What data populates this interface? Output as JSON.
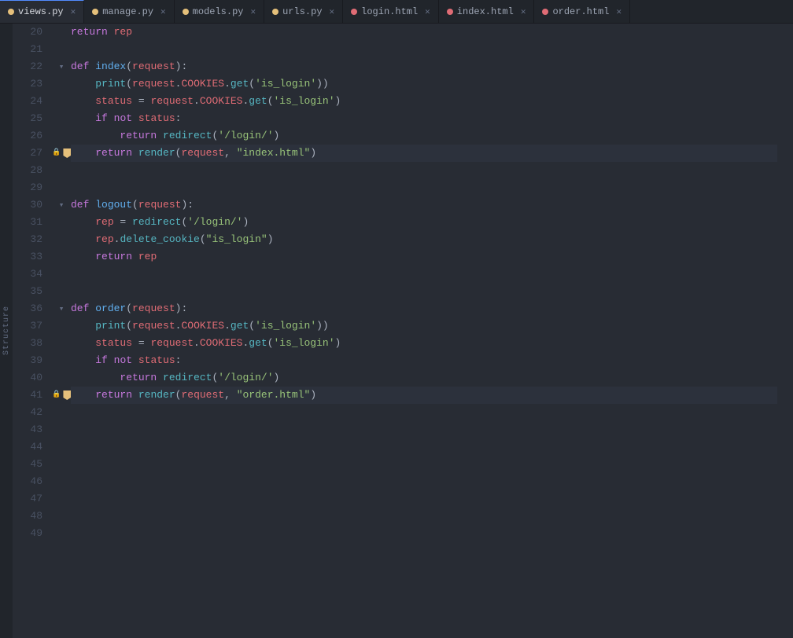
{
  "tabs": [
    {
      "id": "views-py",
      "label": "views.py",
      "active": true,
      "color": "#e5c07b",
      "dot_color": "#e5c07b"
    },
    {
      "id": "manage-py",
      "label": "manage.py",
      "active": false,
      "color": "#e5c07b",
      "dot_color": "#e5c07b"
    },
    {
      "id": "models-py",
      "label": "models.py",
      "active": false,
      "color": "#e5c07b",
      "dot_color": "#e5c07b"
    },
    {
      "id": "urls-py",
      "label": "urls.py",
      "active": false,
      "color": "#e5c07b",
      "dot_color": "#e5c07b"
    },
    {
      "id": "login-html",
      "label": "login.html",
      "active": false,
      "color": "#e06c75",
      "dot_color": "#e06c75"
    },
    {
      "id": "index-html",
      "label": "index.html",
      "active": false,
      "color": "#e06c75",
      "dot_color": "#e06c75"
    },
    {
      "id": "order-html",
      "label": "order.html",
      "active": false,
      "color": "#e06c75",
      "dot_color": "#e06c75"
    }
  ],
  "structure_label": "Structure",
  "lines": [
    {
      "num": 20,
      "gutter": "",
      "content": "return rep",
      "has_bookmark": false,
      "has_fold": false
    },
    {
      "num": 21,
      "gutter": "",
      "content": "",
      "has_bookmark": false,
      "has_fold": false
    },
    {
      "num": 22,
      "gutter": "fold",
      "content": "def index(request):",
      "has_bookmark": false,
      "has_fold": true
    },
    {
      "num": 23,
      "gutter": "",
      "content": "    print(request.COOKIES.get('is_login'))",
      "has_bookmark": false,
      "has_fold": false
    },
    {
      "num": 24,
      "gutter": "",
      "content": "    status = request.COOKIES.get('is_login')",
      "has_bookmark": false,
      "has_fold": false
    },
    {
      "num": 25,
      "gutter": "",
      "content": "    if not status:",
      "has_bookmark": false,
      "has_fold": false
    },
    {
      "num": 26,
      "gutter": "",
      "content": "        return redirect('/login/')",
      "has_bookmark": false,
      "has_fold": false
    },
    {
      "num": 27,
      "gutter": "bookmark",
      "content": "    return render(request, \"index.html\")",
      "has_bookmark": true,
      "has_fold": false
    },
    {
      "num": 28,
      "gutter": "",
      "content": "",
      "has_bookmark": false,
      "has_fold": false
    },
    {
      "num": 29,
      "gutter": "",
      "content": "",
      "has_bookmark": false,
      "has_fold": false
    },
    {
      "num": 30,
      "gutter": "fold",
      "content": "def logout(request):",
      "has_bookmark": false,
      "has_fold": true
    },
    {
      "num": 31,
      "gutter": "",
      "content": "    rep = redirect('/login/')",
      "has_bookmark": false,
      "has_fold": false
    },
    {
      "num": 32,
      "gutter": "",
      "content": "    rep.delete_cookie(\"is_login\")",
      "has_bookmark": false,
      "has_fold": false
    },
    {
      "num": 33,
      "gutter": "",
      "content": "    return rep",
      "has_bookmark": false,
      "has_fold": false
    },
    {
      "num": 34,
      "gutter": "",
      "content": "",
      "has_bookmark": false,
      "has_fold": false
    },
    {
      "num": 35,
      "gutter": "",
      "content": "",
      "has_bookmark": false,
      "has_fold": false
    },
    {
      "num": 36,
      "gutter": "fold",
      "content": "def order(request):",
      "has_bookmark": false,
      "has_fold": true
    },
    {
      "num": 37,
      "gutter": "",
      "content": "    print(request.COOKIES.get('is_login'))",
      "has_bookmark": false,
      "has_fold": false
    },
    {
      "num": 38,
      "gutter": "",
      "content": "    status = request.COOKIES.get('is_login')",
      "has_bookmark": false,
      "has_fold": false
    },
    {
      "num": 39,
      "gutter": "",
      "content": "    if not status:",
      "has_bookmark": false,
      "has_fold": false
    },
    {
      "num": 40,
      "gutter": "",
      "content": "        return redirect('/login/')",
      "has_bookmark": false,
      "has_fold": false
    },
    {
      "num": 41,
      "gutter": "bookmark",
      "content": "    return render(request, \"order.html\")",
      "has_bookmark": true,
      "has_fold": false
    },
    {
      "num": 42,
      "gutter": "",
      "content": "",
      "has_bookmark": false,
      "has_fold": false
    },
    {
      "num": 43,
      "gutter": "",
      "content": "",
      "has_bookmark": false,
      "has_fold": false
    },
    {
      "num": 44,
      "gutter": "",
      "content": "",
      "has_bookmark": false,
      "has_fold": false
    },
    {
      "num": 45,
      "gutter": "",
      "content": "",
      "has_bookmark": false,
      "has_fold": false
    },
    {
      "num": 46,
      "gutter": "",
      "content": "",
      "has_bookmark": false,
      "has_fold": false
    },
    {
      "num": 47,
      "gutter": "",
      "content": "",
      "has_bookmark": false,
      "has_fold": false
    },
    {
      "num": 48,
      "gutter": "",
      "content": "",
      "has_bookmark": false,
      "has_fold": false
    },
    {
      "num": 49,
      "gutter": "",
      "content": "",
      "has_bookmark": false,
      "has_fold": false
    }
  ]
}
